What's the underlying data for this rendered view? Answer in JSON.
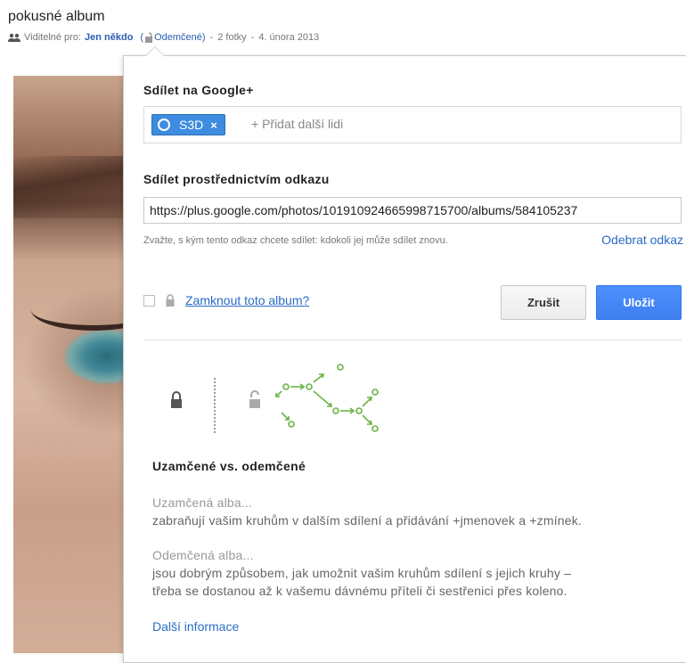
{
  "album": {
    "title": "pokusné album",
    "visible_for_label": "Viditelné pro:",
    "visible_for_value": "Jen někdo",
    "lock_status": "Odemčené",
    "photo_count": "2 fotky",
    "date": "4. února 2013"
  },
  "share": {
    "title": "Sdílet na Google+",
    "chip_label": "S3D",
    "chip_remove": "×",
    "add_placeholder": "+ Přidat další lidi"
  },
  "link": {
    "title": "Sdílet prostřednictvím odkazu",
    "url": "https://plus.google.com/photos/101910924665998715700/albums/584105237",
    "hint": "Zvažte, s kým tento odkaz chcete sdílet: kdokoli jej může sdílet znovu.",
    "remove_label": "Odebrat odkaz"
  },
  "lock": {
    "checked": false,
    "label": "Zamknout toto album?"
  },
  "buttons": {
    "cancel": "Zrušit",
    "save": "Uložit"
  },
  "info": {
    "title": "Uzamčené vs. odemčené",
    "locked_heading": "Uzamčená alba...",
    "locked_text": "zabraňují vašim kruhům v dalším sdílení a přidávání +jmenovek a +zmínek.",
    "unlocked_heading": "Odemčená alba...",
    "unlocked_text_1": "jsou dobrým způsobem, jak umožnit vašim kruhům sdílení s jejich kruhy –",
    "unlocked_text_2": "třeba se dostanou až k vašemu dávnému příteli či sestřenici přes koleno.",
    "more_label": "Další informace"
  },
  "colors": {
    "accent": "#4d90fe",
    "link": "#2a6cc6",
    "diagram_green": "#6ab344"
  }
}
